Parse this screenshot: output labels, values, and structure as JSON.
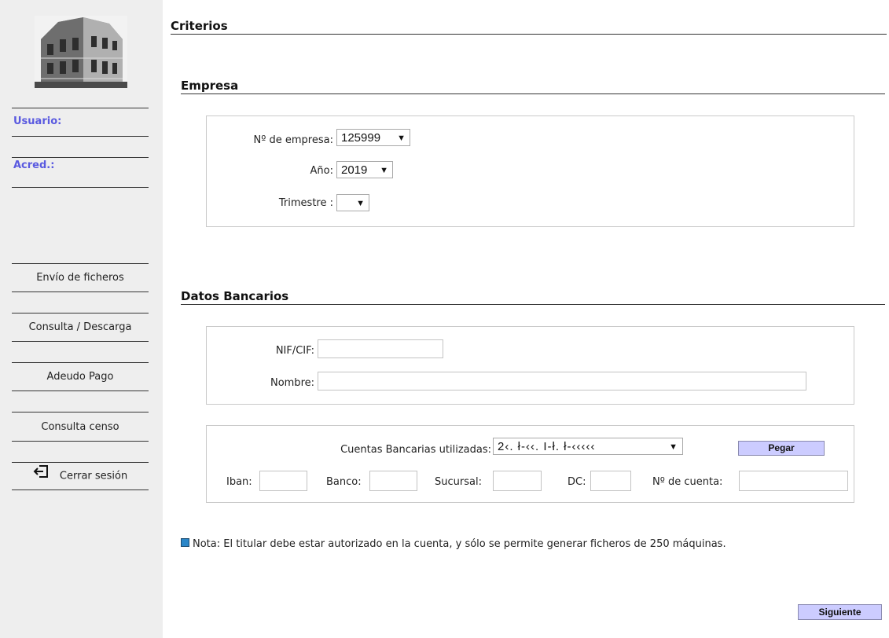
{
  "sidebar": {
    "user_label": "Usuario:",
    "acred_label": "Acred.:",
    "nav": [
      {
        "label": "Envío de ficheros"
      },
      {
        "label": "Consulta / Descarga"
      },
      {
        "label": "Adeudo Pago"
      },
      {
        "label": "Consulta censo"
      },
      {
        "label": "Cerrar sesión",
        "icon": "logout-icon"
      }
    ]
  },
  "main": {
    "title": "Criterios",
    "empresa": {
      "title": "Empresa",
      "num_empresa_label": "Nº de empresa:",
      "num_empresa_value": "125999",
      "anio_label": "Año:",
      "anio_value": "2019",
      "trimestre_label": "Trimestre :",
      "trimestre_value": ""
    },
    "datos_bancarios": {
      "title": "Datos Bancarios",
      "nif_label": "NIF/CIF:",
      "nif_value": "",
      "nombre_label": "Nombre:",
      "nombre_value": "",
      "cuentas_label": "Cuentas Bancarias utilizadas:",
      "cuentas_value": "2‹. ł-‹‹. I-ł. ł-‹‹‹‹‹",
      "pegar_label": "Pegar",
      "iban_label": "Iban:",
      "banco_label": "Banco:",
      "sucursal_label": "Sucursal:",
      "dc_label": "DC:",
      "cuenta_label": "Nº de cuenta:"
    },
    "note": "Nota: El titular debe estar autorizado en la cuenta, y sólo se permite generar ficheros de 250 máquinas.",
    "siguiente_label": "Siguiente"
  },
  "colors": {
    "sidebar_bg": "#eeeeee",
    "label_accent": "#5a5ae0",
    "button_bg": "#ccccff",
    "note_bullet": "#2a86c8"
  }
}
